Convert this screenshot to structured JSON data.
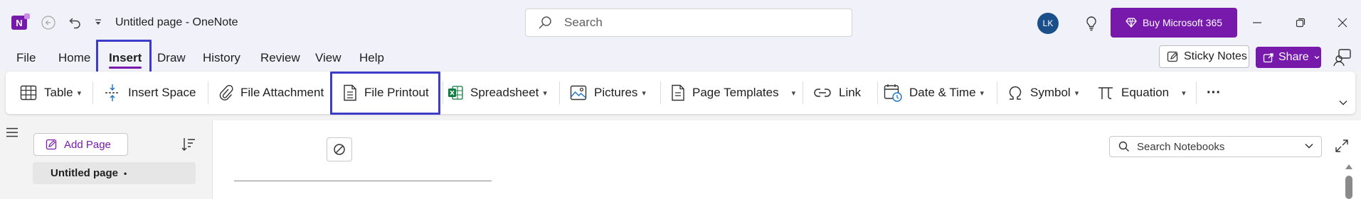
{
  "titlebar": {
    "app_logo_letter": "N",
    "title": "Untitled page  -  OneNote",
    "search_placeholder": "Search",
    "avatar_initials": "LK",
    "buy_label": "Buy Microsoft 365"
  },
  "menu": {
    "tabs": [
      "File",
      "Home",
      "Insert",
      "Draw",
      "History",
      "Review",
      "View",
      "Help"
    ],
    "active_tab": "Insert",
    "sticky_notes_label": "Sticky Notes",
    "share_label": "Share"
  },
  "ribbon": {
    "table": "Table",
    "insert_space": "Insert Space",
    "file_attachment": "File Attachment",
    "file_printout": "File Printout",
    "spreadsheet": "Spreadsheet",
    "pictures": "Pictures",
    "page_templates": "Page Templates",
    "link": "Link",
    "date_time": "Date & Time",
    "symbol": "Symbol",
    "equation": "Equation",
    "more": "···"
  },
  "pages": {
    "add_page_label": "Add Page",
    "items": [
      {
        "label": "Untitled page",
        "marker": "•"
      }
    ]
  },
  "notebook_search": {
    "placeholder": "Search Notebooks"
  },
  "colors": {
    "accent": "#7719aa",
    "highlight_box": "#3c3cc9",
    "avatar": "#1b4f8a",
    "excel_green": "#107c41"
  }
}
